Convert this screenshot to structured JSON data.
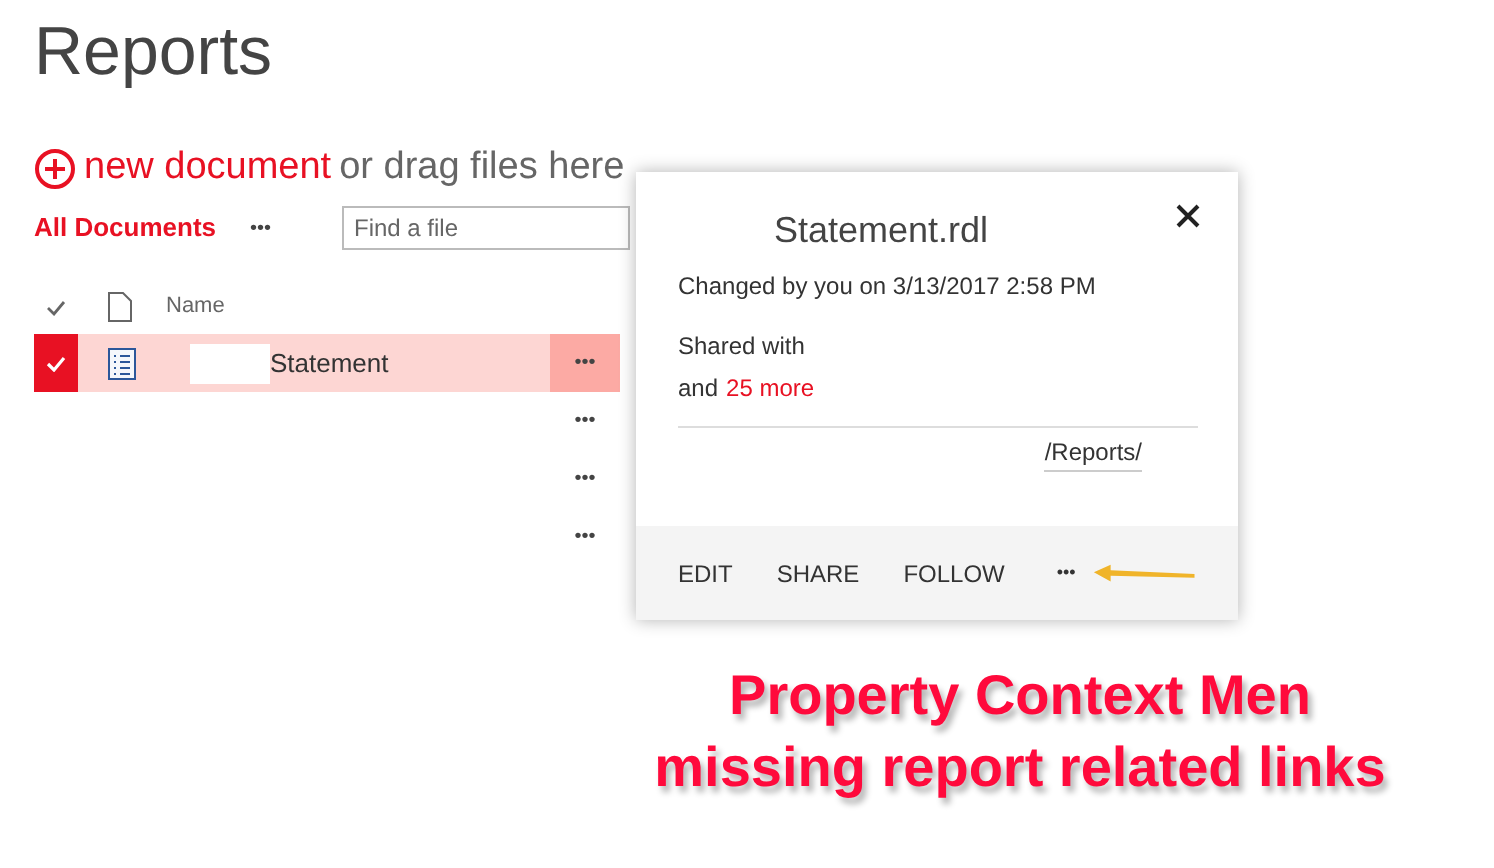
{
  "page_title": "Reports",
  "new_document": {
    "link": "new document",
    "rest": "or drag files here"
  },
  "view": {
    "label": "All Documents",
    "more": "•••"
  },
  "search": {
    "placeholder": "Find a file"
  },
  "columns": {
    "name": "Name"
  },
  "rows": [
    {
      "name": "Statement",
      "more": "•••",
      "selected": true
    },
    {
      "name": "",
      "more": "•••",
      "selected": false
    },
    {
      "name": "",
      "more": "•••",
      "selected": false
    },
    {
      "name": "",
      "more": "•••",
      "selected": false
    }
  ],
  "callout": {
    "title": "Statement.rdl",
    "changed": "Changed by you on 3/13/2017 2:58 PM",
    "shared": "Shared with",
    "and": "and",
    "more_link": "25 more",
    "path": "/Reports/",
    "actions": [
      "EDIT",
      "SHARE",
      "FOLLOW"
    ],
    "more": "•••"
  },
  "annotation": [
    "Property Context Men",
    "missing report related links"
  ]
}
